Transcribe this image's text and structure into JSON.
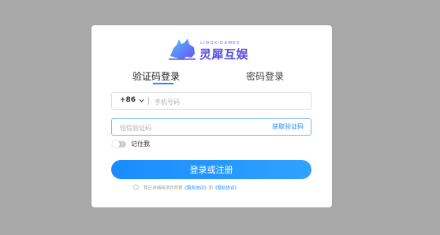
{
  "logo": {
    "brand_en": "LINGXIGAMES",
    "brand_cn": "灵犀互娱"
  },
  "tabs": [
    {
      "label": "验证码登录",
      "active": true
    },
    {
      "label": "密码登录",
      "active": false
    }
  ],
  "phone": {
    "country_code": "+86",
    "placeholder": "手机号码"
  },
  "code": {
    "placeholder": "短信验证码",
    "get_code_label": "获取验证码"
  },
  "remember": {
    "label": "记住我",
    "enabled": false
  },
  "login_button": "登录或注册",
  "agreement": {
    "prefix": "我已详细阅读并同意",
    "service_link": "《服务协议》",
    "conjunction": "和",
    "privacy_link": "《隐私协议》",
    "checked": false
  },
  "colors": {
    "accent": "#1a8cff",
    "brand": "#5a4fe0",
    "backdrop": "#a8a8a8"
  }
}
